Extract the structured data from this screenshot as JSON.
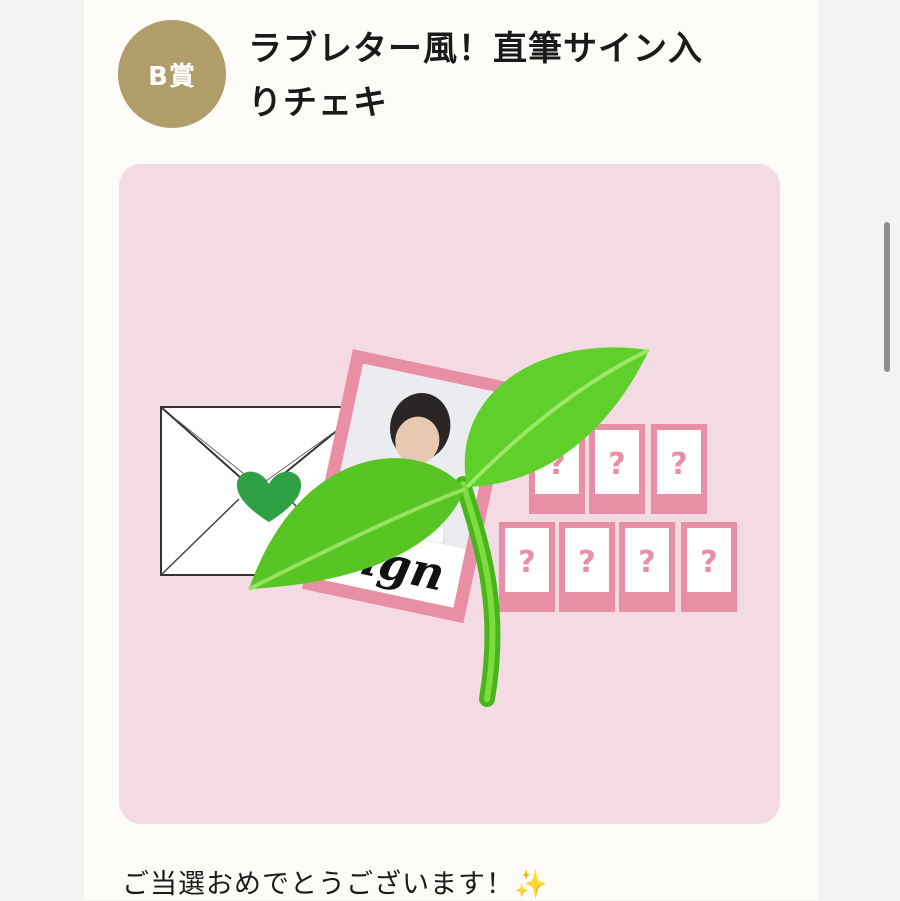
{
  "prize": {
    "badge_label": "B賞",
    "title_line1": "ラブレター風！直筆サイン入",
    "title_line2": "りチェキ"
  },
  "image": {
    "signature_text": "sign",
    "placeholder_mark": "?",
    "colors": {
      "background": "#f4dbe3",
      "frame_pink": "#e98fa5",
      "leaf_green": "#5fcf2c"
    }
  },
  "message": "ご当選おめでとうございます！✨"
}
